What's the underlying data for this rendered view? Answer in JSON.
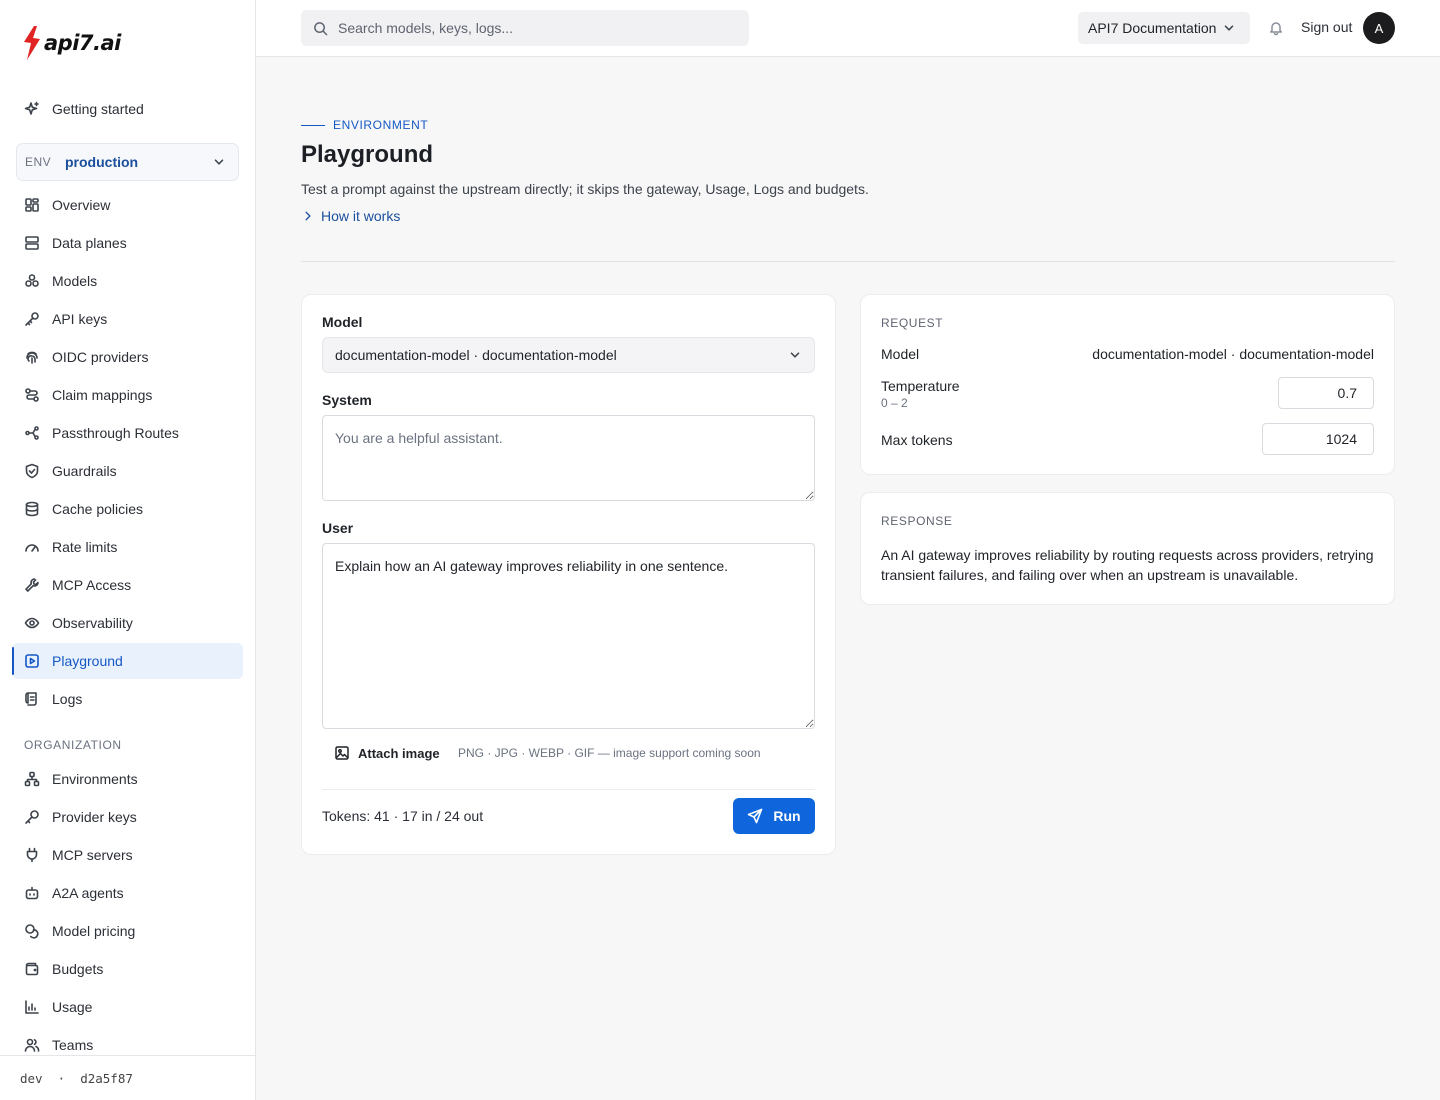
{
  "brand": {
    "logo_text": "API7.AI",
    "accent": "#e02424"
  },
  "search": {
    "placeholder": "Search models, keys, logs..."
  },
  "header": {
    "docs_label": "API7 Documentation",
    "sign_out": "Sign out",
    "avatar_initial": "A"
  },
  "sidebar": {
    "getting_started": "Getting started",
    "env": {
      "label": "ENV",
      "value": "production"
    },
    "items": [
      {
        "label": "Overview",
        "icon": "dashboard-icon"
      },
      {
        "label": "Data planes",
        "icon": "server-icon"
      },
      {
        "label": "Models",
        "icon": "boxes-icon"
      },
      {
        "label": "API keys",
        "icon": "key-icon"
      },
      {
        "label": "OIDC providers",
        "icon": "fingerprint-icon"
      },
      {
        "label": "Claim mappings",
        "icon": "route-icon"
      },
      {
        "label": "Passthrough Routes",
        "icon": "shuffle-icon"
      },
      {
        "label": "Guardrails",
        "icon": "shield-icon"
      },
      {
        "label": "Cache policies",
        "icon": "database-icon"
      },
      {
        "label": "Rate limits",
        "icon": "gauge-icon"
      },
      {
        "label": "MCP Access",
        "icon": "wrench-icon"
      },
      {
        "label": "Observability",
        "icon": "eye-icon"
      },
      {
        "label": "Playground",
        "icon": "play-square-icon",
        "active": true
      },
      {
        "label": "Logs",
        "icon": "scroll-icon"
      }
    ],
    "org_label": "ORGANIZATION",
    "org_items": [
      {
        "label": "Environments",
        "icon": "network-icon"
      },
      {
        "label": "Provider keys",
        "icon": "key-round-icon"
      },
      {
        "label": "MCP servers",
        "icon": "plug-icon"
      },
      {
        "label": "A2A agents",
        "icon": "bot-icon"
      },
      {
        "label": "Model pricing",
        "icon": "coins-icon"
      },
      {
        "label": "Budgets",
        "icon": "wallet-icon"
      },
      {
        "label": "Usage",
        "icon": "chart-icon"
      },
      {
        "label": "Teams",
        "icon": "users-icon"
      }
    ],
    "footer": "dev  ·  d2a5f87"
  },
  "page": {
    "eyebrow": "ENVIRONMENT",
    "title": "Playground",
    "subtitle": "Test a prompt against the upstream directly; it skips the gateway, Usage, Logs and budgets.",
    "how_it_works": "How it works"
  },
  "form": {
    "model_label": "Model",
    "model_value": "documentation-model · documentation-model",
    "system_label": "System",
    "system_placeholder": "You are a helpful assistant.",
    "user_label": "User",
    "user_value": "Explain how an AI gateway improves reliability in one sentence.",
    "attach_label": "Attach image",
    "attach_hint": "PNG · JPG · WEBP · GIF — image support coming soon",
    "tokens": "Tokens: 41 · 17 in / 24 out",
    "run_label": "Run"
  },
  "request": {
    "label": "REQUEST",
    "model_key": "Model",
    "model_value": "documentation-model · documentation-model",
    "temperature_key": "Temperature",
    "temperature_range": "0 – 2",
    "temperature_value": "0.7",
    "max_tokens_key": "Max tokens",
    "max_tokens_value": "1024"
  },
  "response": {
    "label": "RESPONSE",
    "text": "An AI gateway improves reliability by routing requests across providers, retrying transient failures, and failing over when an upstream is unavailable."
  }
}
